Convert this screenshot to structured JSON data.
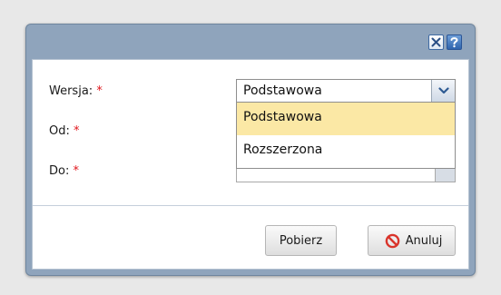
{
  "form": {
    "wersja_label": "Wersja:",
    "od_label": "Od:",
    "do_label": "Do:",
    "required_mark": "*"
  },
  "select": {
    "value": "Podstawowa",
    "options": [
      "Podstawowa",
      "Rozszerzona"
    ]
  },
  "buttons": {
    "pobierz": "Pobierz",
    "anuluj": "Anuluj"
  },
  "icons": {
    "close": "close-icon",
    "help": "help-icon",
    "dropdown": "chevron-down-icon",
    "cancel": "cancel-icon"
  },
  "colors": {
    "title_bar": "#8fa4bc",
    "required": "#e0151b",
    "selected_option": "#fbe8a5",
    "cancel_icon": "#d9342b"
  }
}
